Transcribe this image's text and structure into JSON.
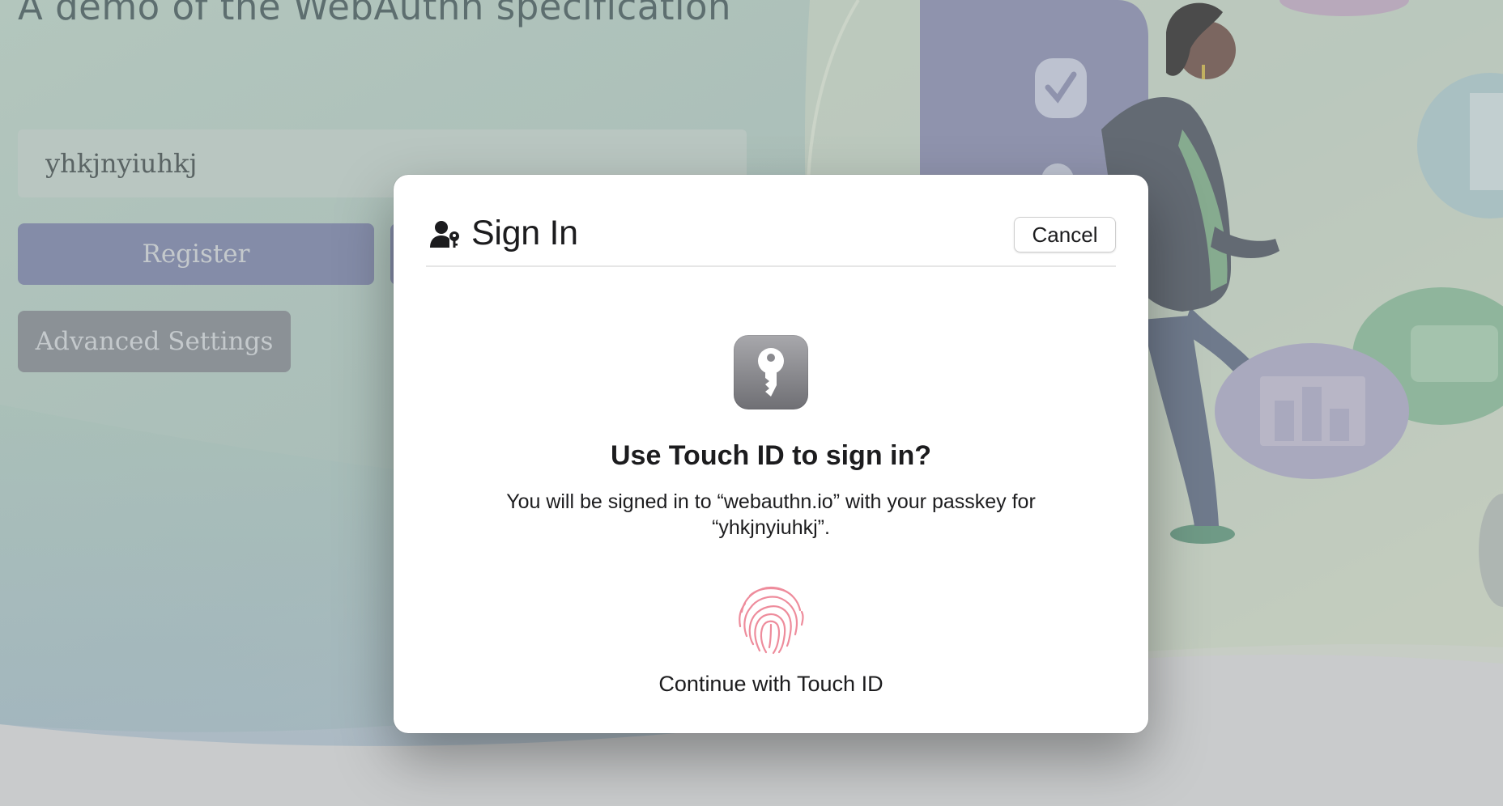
{
  "background_page": {
    "heading": "A demo of the WebAuthn specification",
    "username_value": "yhkjnyiuhkj",
    "register_label": "Register",
    "advanced_settings_label": "Advanced Settings"
  },
  "dialog": {
    "title": "Sign In",
    "header_icon": "person-key-icon",
    "cancel_label": "Cancel",
    "main_icon": "passkey-key-icon",
    "heading": "Use Touch ID to sign in?",
    "message": "You will be signed in to “webauthn.io” with your passkey for “yhkjnyiuhkj”.",
    "touch_id_icon": "fingerprint-icon",
    "touch_id_label": "Continue with Touch ID"
  },
  "colors": {
    "dialog_background": "#ffffff",
    "overlay_tint": "#c9cbcc",
    "register_button": "#848ca8",
    "advanced_button": "#8b9196",
    "fingerprint": "#ee8c9c",
    "passkey_tile": "#8e8e93"
  }
}
